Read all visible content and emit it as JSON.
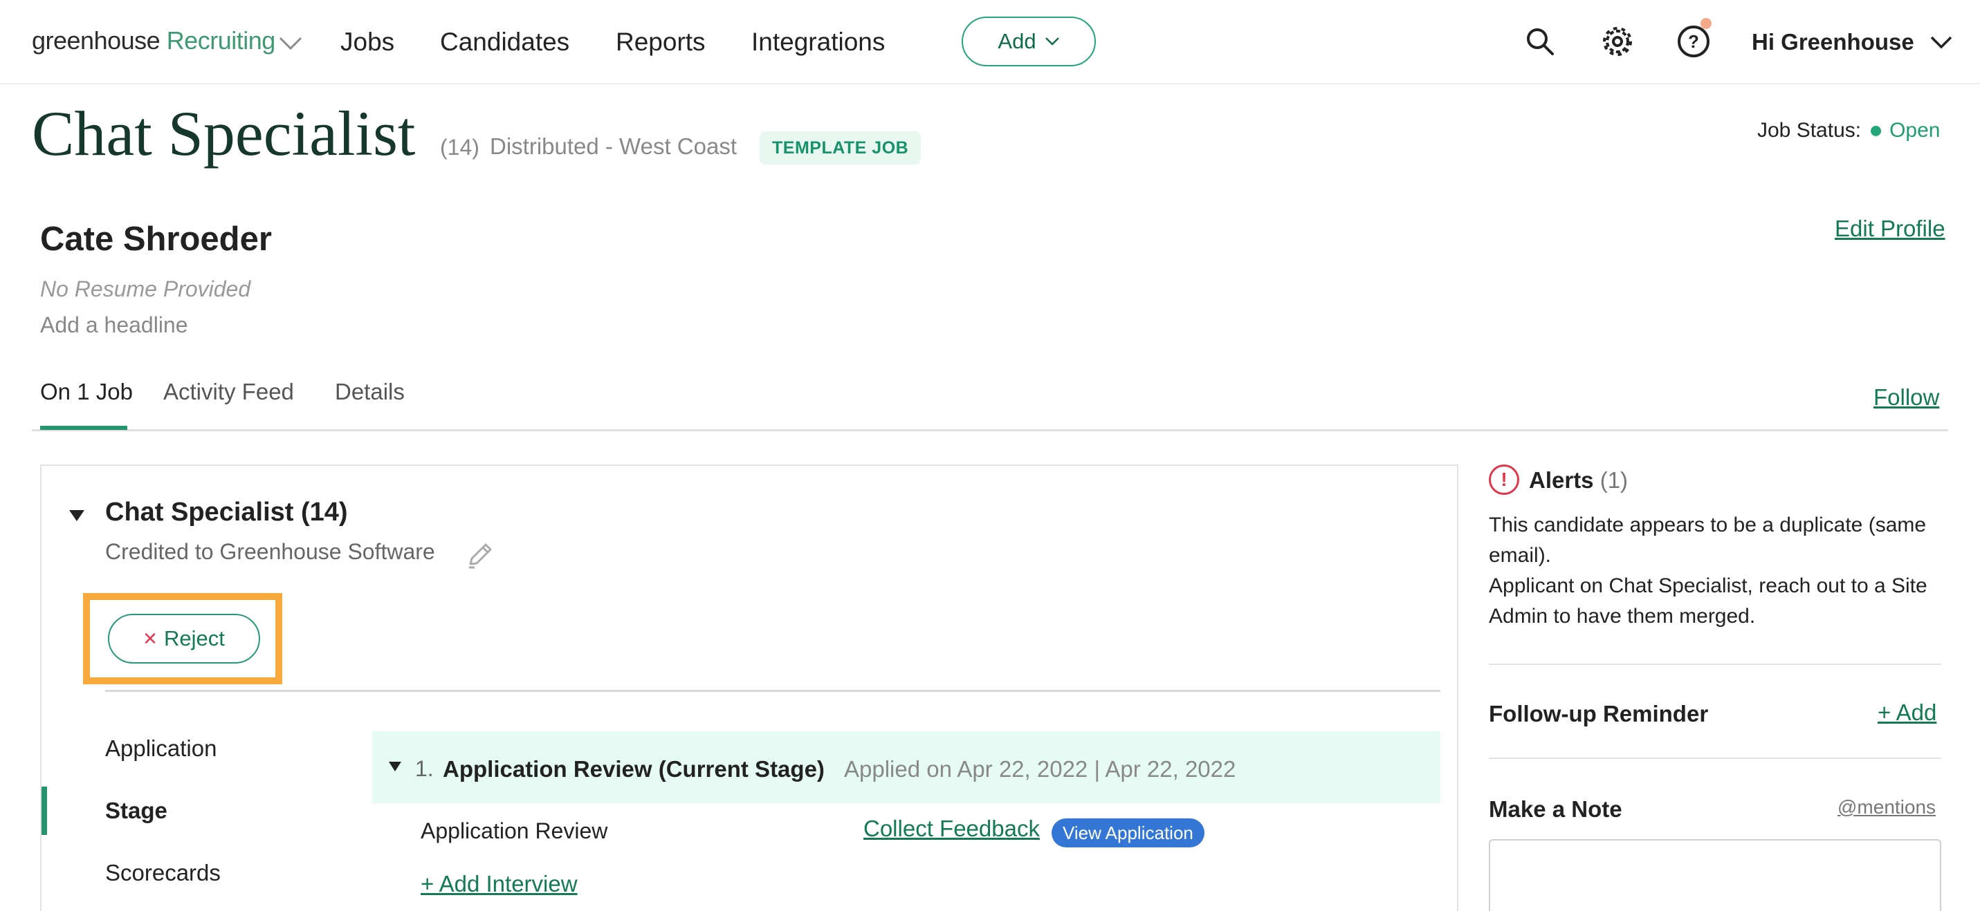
{
  "nav": {
    "logo_main": "greenhouse",
    "logo_product": "Recruiting",
    "links": [
      "Jobs",
      "Candidates",
      "Reports",
      "Integrations"
    ],
    "add_label": "Add",
    "user_greeting": "Hi Greenhouse",
    "icons": [
      "search-icon",
      "gear-icon",
      "help-icon"
    ]
  },
  "job": {
    "title": "Chat Specialist",
    "count": "(14)",
    "location": "Distributed - West Coast",
    "badge": "TEMPLATE JOB",
    "status_label": "Job Status:",
    "status_value": "Open",
    "status_color": "#23a67a"
  },
  "candidate": {
    "name": "Cate Shroeder",
    "resume": "No Resume Provided",
    "headline_prompt": "Add a headline",
    "edit_profile": "Edit Profile"
  },
  "tabs": {
    "items": [
      "On 1 Job",
      "Activity Feed",
      "Details"
    ],
    "active": "On 1 Job",
    "follow": "Follow"
  },
  "application": {
    "title": "Chat Specialist (14)",
    "credited": "Credited to Greenhouse Software",
    "reject_label": "Reject",
    "side_nav": [
      "Application",
      "Stage",
      "Scorecards"
    ],
    "side_active": "Stage",
    "stage": {
      "number": "1.",
      "name": "Application Review (Current Stage)",
      "applied": "Applied on Apr 22, 2022 | Apr 22, 2022"
    },
    "interview_name": "Application Review",
    "collect_feedback": "Collect Feedback",
    "view_application": "View Application",
    "add_interview": "+ Add Interview"
  },
  "right_panel": {
    "alerts_title": "Alerts",
    "alerts_count": "(1)",
    "alert_line1": "This candidate appears to be a duplicate (same email).",
    "alert_line2": "Applicant on Chat Specialist, reach out to a Site Admin to have them merged.",
    "followup_title": "Follow-up Reminder",
    "followup_add": "+ Add",
    "note_title": "Make a Note",
    "mentions": "@mentions"
  },
  "colors": {
    "brand_green": "#137a55",
    "highlight": "#f7a93b",
    "alert_red": "#e1374c",
    "badge_blue": "#3476d6"
  }
}
